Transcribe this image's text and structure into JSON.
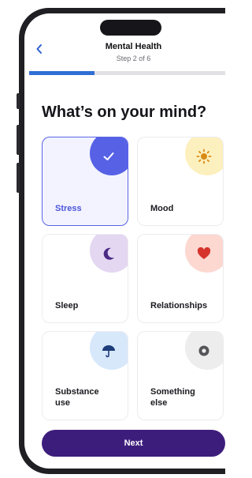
{
  "header": {
    "back_icon": "chevron-left-icon",
    "title": "Mental Health",
    "step": "Step 2 of 6"
  },
  "progress": {
    "fraction": 0.333,
    "color": "#2f6fd6"
  },
  "question": "What’s on your mind?",
  "options": [
    {
      "label": "Stress",
      "icon": "checkmark-icon",
      "selected": true,
      "blob_color": "#5661e6"
    },
    {
      "label": "Mood",
      "icon": "sun-icon",
      "selected": false,
      "blob_color": "#fdf0bf"
    },
    {
      "label": "Sleep",
      "icon": "moon-icon",
      "selected": false,
      "blob_color": "#e4d7f2"
    },
    {
      "label": "Relationships",
      "icon": "heart-icon",
      "selected": false,
      "blob_color": "#fcd8d1"
    },
    {
      "label": "Substance use",
      "icon": "umbrella-icon",
      "selected": false,
      "blob_color": "#d7e8fb"
    },
    {
      "label": "Something else",
      "icon": "circle-dot-icon",
      "selected": false,
      "blob_color": "#ededee"
    }
  ],
  "next_button": {
    "label": "Next",
    "color": "#3d1d7c"
  },
  "accent": "#5661e6"
}
